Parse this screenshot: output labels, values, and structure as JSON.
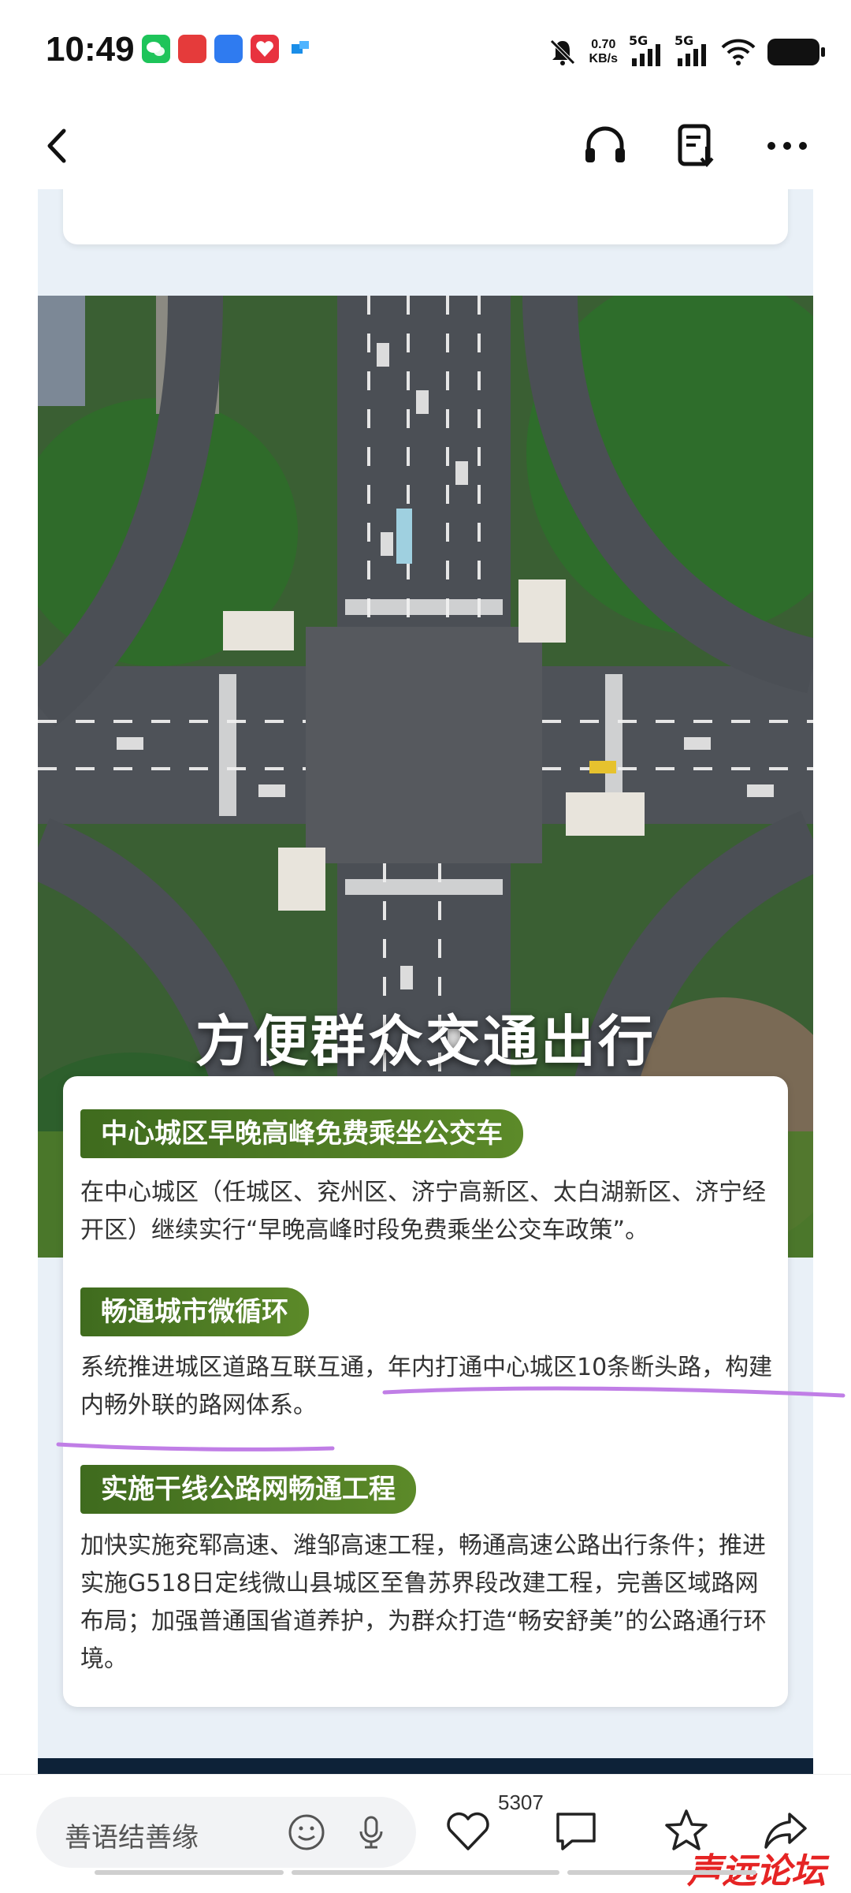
{
  "status_bar": {
    "time": "10:49",
    "net_speed_value": "0.70",
    "net_speed_unit": "KB/s",
    "signal1_label": "5G",
    "signal2_label": "5G",
    "icons": [
      "wechat-icon",
      "app-icon-red",
      "app-icon-blue",
      "app-icon-heart",
      "app-icon-flag",
      "mute-icon",
      "wifi-icon",
      "battery-icon"
    ]
  },
  "nav": {
    "icons": [
      "back-icon",
      "headphones-icon",
      "note-download-icon",
      "more-icon"
    ]
  },
  "poster": {
    "headline": "方便群众交通出行",
    "sections": [
      {
        "title": "中心城区早晚高峰免费乘坐公交车",
        "text": "在中心城区（任城区、兖州区、济宁高新区、太白湖新区、济宁经开区）继续实行“早晚高峰时段免费乘坐公交车政策”。"
      },
      {
        "title": "畅通城市微循环",
        "text": "系统推进城区道路互联互通，年内打通中心城区10条断头路，构建内畅外联的路网体系。"
      },
      {
        "title": "实施干线公路网畅通工程",
        "text": "加快实施兖郓高速、潍邹高速工程，畅通高速公路出行条件；推进实施G518日定线微山县城区至鲁苏界段改建工程，完善区域路网布局；加强普通国省道养护，为群众打造“畅安舒美”的公路通行环境。"
      }
    ]
  },
  "bottom_bar": {
    "comment_placeholder": "善语结善缘",
    "like_count": "5307",
    "watermark": "声远论坛"
  },
  "colors": {
    "accent_green": "#4e7d24",
    "underline_purple": "#c07ee6"
  }
}
